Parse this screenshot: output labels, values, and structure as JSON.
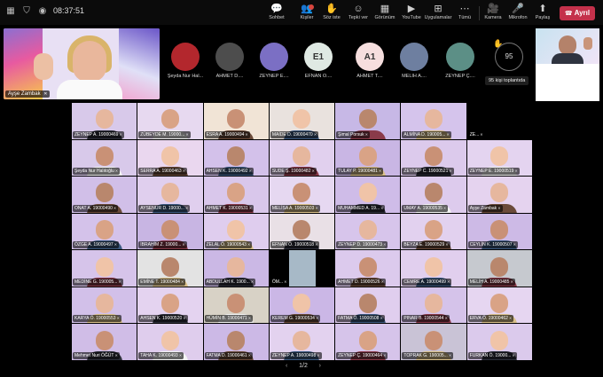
{
  "topbar": {
    "time": "08:37:51",
    "tools": [
      {
        "key": "chat",
        "label": "Sohbet",
        "glyph": "💬"
      },
      {
        "key": "people",
        "label": "Kişiler",
        "glyph": "👥",
        "badge": true
      },
      {
        "key": "raise",
        "label": "Söz iste",
        "glyph": "✋"
      },
      {
        "key": "react",
        "label": "Tepki ver",
        "glyph": "☺"
      },
      {
        "key": "view",
        "label": "Görünüm",
        "glyph": "▦"
      },
      {
        "key": "youtube",
        "label": "YouTube",
        "glyph": "▶"
      },
      {
        "key": "apps",
        "label": "Uygulamalar",
        "glyph": "⊞"
      },
      {
        "key": "more",
        "label": "Tümü",
        "glyph": "⋯"
      },
      {
        "key": "camera",
        "label": "Kamera",
        "glyph": "🎥"
      },
      {
        "key": "mic",
        "label": "Mikrofon",
        "glyph": "🎤"
      },
      {
        "key": "share",
        "label": "Paylaş",
        "glyph": "⬆"
      }
    ],
    "leave_label": "Ayrıl"
  },
  "speaker": {
    "name": "Ayşe Zambak"
  },
  "avatar_strip": [
    {
      "name": "Şeyda Nur Hal...",
      "initials": "",
      "bg": "#b3272d"
    },
    {
      "name": "AHMET D....",
      "initials": "",
      "bg": "#4d4d4d"
    },
    {
      "name": "ZEYNEP E....",
      "initials": "",
      "bg": "#7b6fc4"
    },
    {
      "name": "EFNAN Ö....",
      "initials": "E1",
      "bg": "#dfe9e3"
    },
    {
      "name": "AHMET T....",
      "initials": "A1",
      "bg": "#f6dede"
    },
    {
      "name": "MELİH A....",
      "initials": "",
      "bg": "#6e7fa0"
    },
    {
      "name": "ZEYNEP Ç....",
      "initials": "",
      "bg": "#5c8f86"
    }
  ],
  "more_count": "95",
  "tooltip": "95 kişi toplantıda",
  "grid": {
    "tiles": [
      {
        "name": "ZEYNEP A. 19000469",
        "bg": "#d8c9ea"
      },
      {
        "name": "ZÜBEYDE M. 19000...",
        "bg": "#e7d9f0"
      },
      {
        "name": "ESRA A. 19000494",
        "bg": "#f1e4d6"
      },
      {
        "name": "MAİDE D. 19000470",
        "bg": "#e9e2de"
      },
      {
        "name": "Şimal Porsuk",
        "bg": "#c7b8e6"
      },
      {
        "name": "ALMİNA D. 190005...",
        "bg": "#d5c4ec"
      },
      {
        "name": "ZE...",
        "bg": "#000000",
        "black": true
      },
      {
        "name": "Şeyda Nur Halıtoğlu",
        "bg": "#d8c9ea"
      },
      {
        "name": "SERRA A. 19000463",
        "bg": "#ead7ef"
      },
      {
        "name": "AHSEN K. 19000492",
        "bg": "#d3c1ea"
      },
      {
        "name": "SUDE Ş. 19000482",
        "bg": "#e1d0ee"
      },
      {
        "name": "TULAY P. 19000481",
        "bg": "#c9b6e4"
      },
      {
        "name": "ZEYNEP C. 19000521",
        "bg": "#dccaec"
      },
      {
        "name": "ZEYNEP E. 19000519",
        "bg": "#e4d4f0"
      },
      {
        "name": "ONAT A. 19000490",
        "bg": "#d1bfe8"
      },
      {
        "name": "AYSENUR D. 19000...",
        "bg": "#e0cfee"
      },
      {
        "name": "AHMET K. 19000531",
        "bg": "#d9c7eb"
      },
      {
        "name": "MELİSA A. 19000503",
        "bg": "#e6d8f1"
      },
      {
        "name": "MUHAMMED A. 19...",
        "bg": "#cfbce8"
      },
      {
        "name": "UMAY A. 19000535",
        "bg": "#ddcbed"
      },
      {
        "name": "Ayşe Zambak",
        "bg": "#e5d3ef"
      },
      {
        "name": "ÖZGE A. 19000497",
        "bg": "#d4c2ea"
      },
      {
        "name": "İBRAHİM Z. 19000...",
        "bg": "#c8b5e3"
      },
      {
        "name": "ZELAL Ö. 19000543",
        "bg": "#dfcdee"
      },
      {
        "name": "EFNAN Ö. 19000518",
        "bg": "#e9e0e6"
      },
      {
        "name": "ZEYNEP D. 19000473",
        "bg": "#d7c5eb"
      },
      {
        "name": "BEYZA E. 19000529",
        "bg": "#e2d1ef"
      },
      {
        "name": "CEYLİN K. 19000507",
        "bg": "#cdbae6"
      },
      {
        "name": "MEDİNE G. 190005...",
        "bg": "#d6c4ea"
      },
      {
        "name": "EMİNE T. 19000484",
        "bg": "#e3e3e3"
      },
      {
        "name": "ABDULLAH K. 1900...",
        "bg": "#cbb8e5"
      },
      {
        "name": "ÖM...",
        "bg": "#000000",
        "black": true,
        "mid": true
      },
      {
        "name": "AHMET D. 19000526",
        "bg": "#dccaed"
      },
      {
        "name": "CEMRE A. 19000499",
        "bg": "#e1cfee"
      },
      {
        "name": "MELİH A. 19000485",
        "bg": "#c6c9cf"
      },
      {
        "name": "KARYA Ö. 19000553",
        "bg": "#d2c0e9"
      },
      {
        "name": "AHSEN K. 19000520",
        "bg": "#e4d3f0"
      },
      {
        "name": "HÜMİN B. 19000471",
        "bg": "#d8d2c6"
      },
      {
        "name": "KEREM G. 19000534",
        "bg": "#cbb7e6"
      },
      {
        "name": "FATMA Ö. 19000508",
        "bg": "#e0ceee"
      },
      {
        "name": "PINAR B. 19000544",
        "bg": "#d5c3ea"
      },
      {
        "name": "ERVA Ö. 19000462",
        "bg": "#e6d6f1"
      },
      {
        "name": "Mehmet Nuri ÖĞÜT",
        "bg": "#d0bde7"
      },
      {
        "name": "TAHA K. 19000493",
        "bg": "#dfcded"
      },
      {
        "name": "FATMA D. 19000461",
        "bg": "#ccb9e6"
      },
      {
        "name": "ZEYNEP A. 19000498",
        "bg": "#e3d2ef"
      },
      {
        "name": "ZEYNEP Ç. 19000464",
        "bg": "#d6c4ea"
      },
      {
        "name": "TOPRAK G. 190005...",
        "bg": "#c9c3d6"
      },
      {
        "name": "FURKAN Ö. 19000...",
        "bg": "#dbcaec"
      }
    ]
  },
  "pager": {
    "label": "1/2"
  }
}
